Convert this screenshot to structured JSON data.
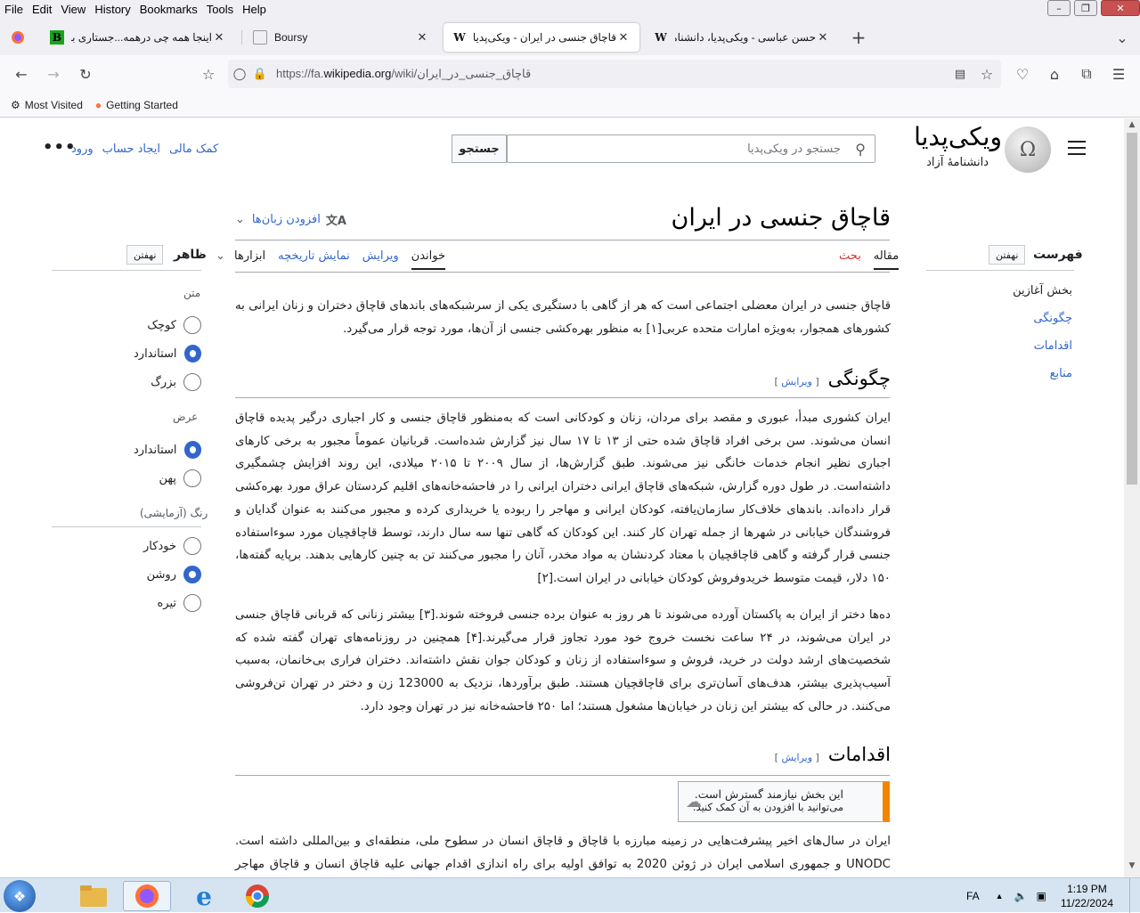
{
  "browser": {
    "menu": [
      "File",
      "Edit",
      "View",
      "History",
      "Bookmarks",
      "Tools",
      "Help"
    ],
    "tabs": [
      {
        "title": "اینجا همه چی درهمه...جستاری برای",
        "active": false
      },
      {
        "title": "Boursy",
        "active": false
      },
      {
        "title": "قاچاق جنسی در ایران - ویکی‌پدیا، دانشنامهٔ آزاد",
        "active": true
      },
      {
        "title": "حسن عباسی - ویکی‌پدیا، دانشنامهٔ آزاد",
        "active": false
      }
    ],
    "url_prefix": "https://fa.",
    "url_domain": "wikipedia.org",
    "url_path": "/wiki/قاچاق_جنسی_در_ایران",
    "bookmarks": [
      "Most Visited",
      "Getting Started"
    ]
  },
  "header": {
    "wordmark": "ویکی‌پدیا",
    "tagline": "دانشنامهٔ آزاد",
    "search_placeholder": "جستجو در ویکی‌پدیا",
    "search_button": "جستجو",
    "user_links": [
      "کمک مالی",
      "ایجاد حساب",
      "ورود"
    ]
  },
  "toc": {
    "title": "فهرست",
    "hide": "نهفتن",
    "items": [
      "بخش آغازین",
      "چگونگی",
      "اقدامات",
      "منابع"
    ]
  },
  "appearance": {
    "title": "ظاهر",
    "hide": "نهفتن",
    "text_label": "متن",
    "text_options": [
      {
        "label": "کوچک",
        "on": false
      },
      {
        "label": "استاندارد",
        "on": true
      },
      {
        "label": "بزرگ",
        "on": false
      }
    ],
    "width_label": "عرض",
    "width_options": [
      {
        "label": "استاندارد",
        "on": true
      },
      {
        "label": "پهن",
        "on": false
      }
    ],
    "color_label": "رنگ (آزمایشی)",
    "color_options": [
      {
        "label": "خودکار",
        "on": false
      },
      {
        "label": "روشن",
        "on": true
      },
      {
        "label": "تیره",
        "on": false
      }
    ]
  },
  "article": {
    "title": "قاچاق جنسی در ایران",
    "languages": "افزودن زبان‌ها",
    "tabs_right": [
      "مقاله",
      "بحث"
    ],
    "tabs_left": [
      "خواندن",
      "ویرایش",
      "نمایش تاریخچه",
      "ابزارها"
    ],
    "intro": "قاچاق جنسی در ایران معضلی اجتماعی است که هر از گاهی با دستگیری یکی از سرشبکه‌های باندهای قاچاق دختران و زنان ایرانی به کشورهای همجوار، به‌ویژه امارات متحده عربی[۱] به منظور بهره‌کشی جنسی از آن‌ها، مورد توجه قرار می‌گیرد.",
    "h2_how": "چگونگی",
    "edit_label": "ویرایش",
    "how_p1": "ایران کشوری مبدأ، عبوری و مقصد برای مردان، زنان و کودکانی است که به‌منظور قاچاق جنسی و کار اجباری درگیر پدیده قاچاق انسان می‌شوند. سن برخی افراد قاچاق شده حتی از ۱۳ تا ۱۷ سال نیز گزارش شده‌است. قربانیان عموماً مجبور به برخی کارهای اجباری نظیر انجام خدمات خانگی نیز می‌شوند. طبق گزارش‌ها، از سال ۲۰۰۹ تا ۲۰۱۵ میلادی، این روند افزایش چشمگیری داشته‌است. در طول دوره گزارش، شبکه‌های قاچاق ایرانی دختران ایرانی را در فاحشه‌خانه‌های اقلیم کردستان عراق مورد بهره‌کشی قرار داده‌اند. باندهای خلاف‌کار سازمان‌یافته، کودکان ایرانی و مهاجر را ربوده یا خریداری کرده و مجبور می‌کنند به عنوان گدایان و فروشندگان خیابانی در شهرها از جمله تهران کار کنند. این کودکان که گاهی تنها سه سال دارند، توسط قاچاقچیان مورد سوءاستفاده جنسی قرار گرفته و گاهی قاچاقچیان با معتاد کردنشان به مواد مخدر، آنان را مجبور می‌کنند تن به چنین کارهایی بدهند. برپایه گفته‌ها، ۱۵۰ دلار، قیمت متوسط خریدوفروش کودکان خیابانی در ایران است.[۲]",
    "how_p2": "ده‌ها دختر از ایران به پاکستان آورده می‌شوند تا هر روز به عنوان برده جنسی فروخته شوند.[۳] بیشتر زنانی که قربانی قاچاق جنسی در ایران می‌شوند، در ۲۴ ساعت نخست خروج خود مورد تجاوز قرار می‌گیرند.[۴] همچنین در روزنامه‌های تهران گفته شده که شخصیت‌های ارشد دولت در خرید، فروش و سوءاستفاده از زنان و کودکان جوان نقش داشته‌اند. دختران فراری بی‌خانمان، به‌سبب آسیب‌پذیری بیشتر، هدف‌های آسان‌تری برای قاچاقچیان هستند. طبق برآوردها، نزدیک به 123000 زن و دختر در تهران تن‌فروشی می‌کنند. در حالی که بیشتر این زنان در خیابان‌ها مشغول هستند؛ اما ۲۵۰ فاحشه‌خانه نیز در تهران وجود دارد.",
    "h2_actions": "اقدامات",
    "ambox_line1": "این بخش نیازمند گسترش است.",
    "ambox_line2": "می‌توانید با افزودن به آن کمک کنید.",
    "actions_p1": "ایران در سال‌های اخیر پیشرفت‌هایی در زمینه مبارزه با قاچاق و قاچاق انسان در سطوح ملی، منطقه‌ای و بین‌المللی داشته است. UNODC و جمهوری اسلامی ایران در ژوئن 2020 به توافق اولیه برای راه اندازی اقدام جهانی علیه قاچاق انسان و قاچاق مهاجر (GLO.ACT- آسیا"
  },
  "taskbar": {
    "lang": "FA",
    "time": "1:19 PM",
    "date": "11/22/2024"
  }
}
